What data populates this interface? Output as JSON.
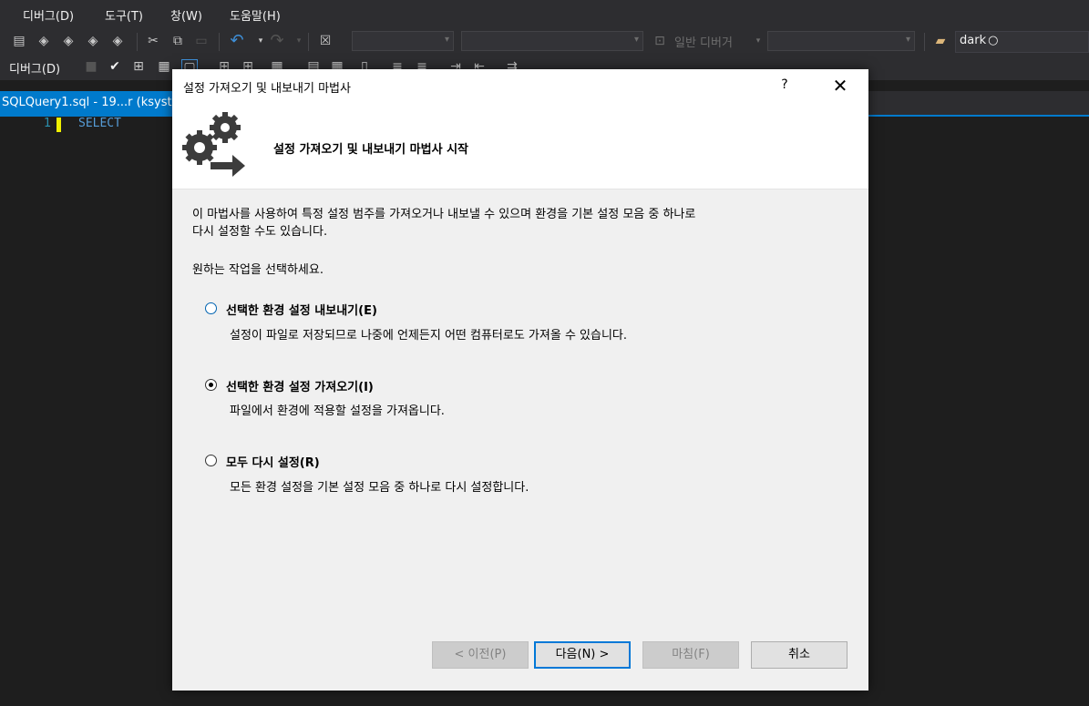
{
  "menubar": {
    "items": [
      "디버그(D)",
      "도구(T)",
      "창(W)",
      "도움말(H)"
    ]
  },
  "toolbar": {
    "solution_config_label": "일반 디버거",
    "search_value": "dark",
    "debug_label": "디버그(D)"
  },
  "tab": {
    "label": "SQLQuery1.sql - 19...r (ksyst"
  },
  "editor": {
    "line_number": "1",
    "code": "SELECT"
  },
  "dialog": {
    "title": "설정 가져오기 및 내보내기 마법사",
    "help": "?",
    "close": "✕",
    "header_title": "설정 가져오기 및 내보내기 마법사 시작",
    "intro_line1": "이 마법사를 사용하여 특정 설정 범주를 가져오거나 내보낼 수 있으며 환경을 기본 설정 모음 중 하나로",
    "intro_line2": "다시 설정할 수도 있습니다.",
    "prompt": "원하는 작업을 선택하세요.",
    "options": [
      {
        "label": "선택한 환경 설정 내보내기(E)",
        "description": "설정이 파일로 저장되므로 나중에 언제든지 어떤 컴퓨터로도 가져올 수 있습니다.",
        "selected": false
      },
      {
        "label": "선택한 환경 설정 가져오기(I)",
        "description": "파일에서 환경에 적용할 설정을 가져옵니다.",
        "selected": true
      },
      {
        "label": "모두 다시 설정(R)",
        "description": "모든 환경 설정을 기본 설정 모음 중 하나로 다시 설정합니다.",
        "selected": false
      }
    ],
    "buttons": {
      "prev": "< 이전(P)",
      "next": "다음(N) >",
      "finish": "마침(F)",
      "cancel": "취소"
    }
  },
  "colors": {
    "accent": "#007acc",
    "ide_bg": "#1e1e1e",
    "dialog_bg": "#f0f0f0"
  }
}
